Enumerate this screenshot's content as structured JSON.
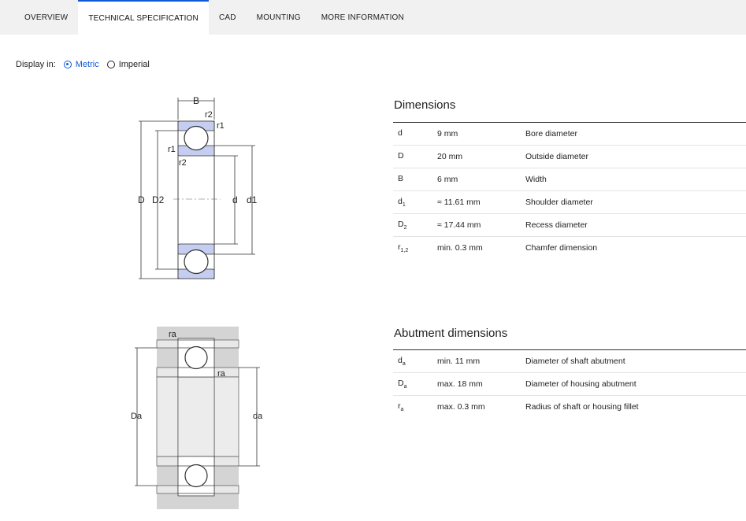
{
  "tabs": [
    {
      "label": "OVERVIEW",
      "active": false
    },
    {
      "label": "TECHNICAL SPECIFICATION",
      "active": true
    },
    {
      "label": "CAD",
      "active": false
    },
    {
      "label": "MOUNTING",
      "active": false
    },
    {
      "label": "MORE INFORMATION",
      "active": false
    }
  ],
  "display": {
    "label": "Display in:",
    "options": [
      {
        "label": "Metric",
        "checked": true
      },
      {
        "label": "Imperial",
        "checked": false
      }
    ]
  },
  "drawing1": {
    "labels": {
      "B": "B",
      "r2_top": "r2",
      "r1_top": "r1",
      "r1_left": "r1",
      "r2_left": "r2",
      "D": "D",
      "D2": "D2",
      "d": "d",
      "d1": "d1"
    }
  },
  "drawing2": {
    "labels": {
      "ra_top": "ra",
      "ra_mid": "ra",
      "Da": "Da",
      "da": "da"
    }
  },
  "dimensions": {
    "title": "Dimensions",
    "rows": [
      {
        "symbol": "d",
        "sub": "",
        "value": "9 mm",
        "desc": "Bore diameter"
      },
      {
        "symbol": "D",
        "sub": "",
        "value": "20 mm",
        "desc": "Outside diameter"
      },
      {
        "symbol": "B",
        "sub": "",
        "value": "6 mm",
        "desc": "Width"
      },
      {
        "symbol": "d",
        "sub": "1",
        "value": "≈ 11.61 mm",
        "desc": "Shoulder diameter"
      },
      {
        "symbol": "D",
        "sub": "2",
        "value": "≈ 17.44 mm",
        "desc": "Recess diameter"
      },
      {
        "symbol": "r",
        "sub": "1,2",
        "value": "min. 0.3 mm",
        "desc": "Chamfer dimension"
      }
    ]
  },
  "abutment": {
    "title": "Abutment dimensions",
    "rows": [
      {
        "symbol": "d",
        "sub": "a",
        "value": "min. 11 mm",
        "desc": "Diameter of shaft abutment"
      },
      {
        "symbol": "D",
        "sub": "a",
        "value": "max. 18 mm",
        "desc": "Diameter of housing abutment"
      },
      {
        "symbol": "r",
        "sub": "a",
        "value": "max. 0.3 mm",
        "desc": "Radius of shaft or housing fillet"
      }
    ]
  },
  "colors": {
    "accent": "#0f58d6",
    "ring_fill": "#c5cef0",
    "housing": "#d4d4d4"
  }
}
